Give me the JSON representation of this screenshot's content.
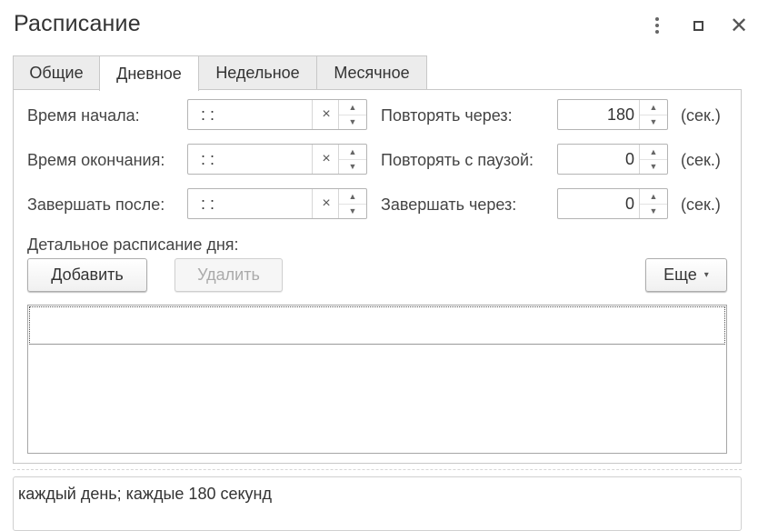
{
  "window": {
    "title": "Расписание",
    "controls": [
      "more-icon",
      "maximize-icon",
      "close-icon"
    ],
    "close_glyph": "✕"
  },
  "tabs": [
    {
      "label": "Общие",
      "active": false
    },
    {
      "label": "Дневное",
      "active": true
    },
    {
      "label": "Недельное",
      "active": false
    },
    {
      "label": "Месячное",
      "active": false
    }
  ],
  "daily": {
    "start_time": {
      "label": "Время начала:",
      "value": " :  :"
    },
    "end_time": {
      "label": "Время окончания:",
      "value": " :  :"
    },
    "finish_after": {
      "label": "Завершать после:",
      "value": " :  :"
    },
    "repeat_every": {
      "label": "Повторять через:",
      "value": "180",
      "unit": "(сек.)"
    },
    "repeat_pause": {
      "label": "Повторять с паузой:",
      "value": "0",
      "unit": "(сек.)"
    },
    "finish_in": {
      "label": "Завершать через:",
      "value": "0",
      "unit": "(сек.)"
    },
    "clear_glyph": "×",
    "detail_label": "Детальное расписание дня:",
    "add_button": "Добавить",
    "delete_button": "Удалить",
    "more_button": "Еще",
    "more_caret": "▾",
    "table_rows": []
  },
  "summary": "каждый день; каждые 180 секунд",
  "colors": {
    "border": "#c8c8c8",
    "tab_inactive_bg": "#ececec",
    "disabled_text": "#aaaaaa"
  }
}
